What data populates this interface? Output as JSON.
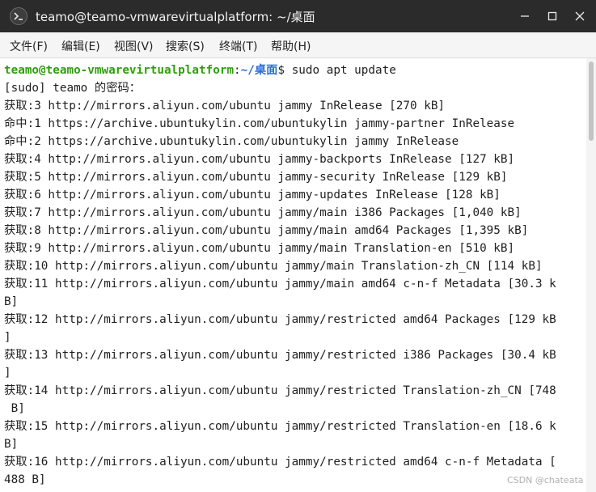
{
  "window": {
    "title": "teamo@teamo-vmwarevirtualplatform: ~/桌面"
  },
  "menubar": {
    "items": [
      {
        "label": "文件(F)"
      },
      {
        "label": "编辑(E)"
      },
      {
        "label": "视图(V)"
      },
      {
        "label": "搜索(S)"
      },
      {
        "label": "终端(T)"
      },
      {
        "label": "帮助(H)"
      }
    ]
  },
  "terminal": {
    "prompt": {
      "user_host": "teamo@teamo-vmwarevirtualplatform",
      "sep": ":",
      "path": "~/桌面",
      "symbol": "$ ",
      "command": "sudo apt update"
    },
    "lines": [
      "[sudo] teamo 的密码：",
      "获取:3 http://mirrors.aliyun.com/ubuntu jammy InRelease [270 kB]",
      "命中:1 https://archive.ubuntukylin.com/ubuntukylin jammy-partner InRelease",
      "命中:2 https://archive.ubuntukylin.com/ubuntukylin jammy InRelease",
      "获取:4 http://mirrors.aliyun.com/ubuntu jammy-backports InRelease [127 kB]",
      "获取:5 http://mirrors.aliyun.com/ubuntu jammy-security InRelease [129 kB]",
      "获取:6 http://mirrors.aliyun.com/ubuntu jammy-updates InRelease [128 kB]",
      "获取:7 http://mirrors.aliyun.com/ubuntu jammy/main i386 Packages [1,040 kB]",
      "获取:8 http://mirrors.aliyun.com/ubuntu jammy/main amd64 Packages [1,395 kB]",
      "获取:9 http://mirrors.aliyun.com/ubuntu jammy/main Translation-en [510 kB]",
      "获取:10 http://mirrors.aliyun.com/ubuntu jammy/main Translation-zh_CN [114 kB]",
      "获取:11 http://mirrors.aliyun.com/ubuntu jammy/main amd64 c-n-f Metadata [30.3 k",
      "B]",
      "获取:12 http://mirrors.aliyun.com/ubuntu jammy/restricted amd64 Packages [129 kB",
      "]",
      "获取:13 http://mirrors.aliyun.com/ubuntu jammy/restricted i386 Packages [30.4 kB",
      "]",
      "获取:14 http://mirrors.aliyun.com/ubuntu jammy/restricted Translation-zh_CN [748",
      " B]",
      "获取:15 http://mirrors.aliyun.com/ubuntu jammy/restricted Translation-en [18.6 k",
      "B]",
      "获取:16 http://mirrors.aliyun.com/ubuntu jammy/restricted amd64 c-n-f Metadata [",
      "488 B]"
    ]
  },
  "watermark": "CSDN @chateata",
  "colors": {
    "titlebar": "#2b2b2b",
    "prompt_user": "#2f9e0f",
    "prompt_path": "#2c6fd1",
    "text": "#1f1f1f"
  },
  "icons": {
    "app": "terminal-icon",
    "minimize": "minimize-icon",
    "maximize": "maximize-icon",
    "close": "close-icon"
  }
}
